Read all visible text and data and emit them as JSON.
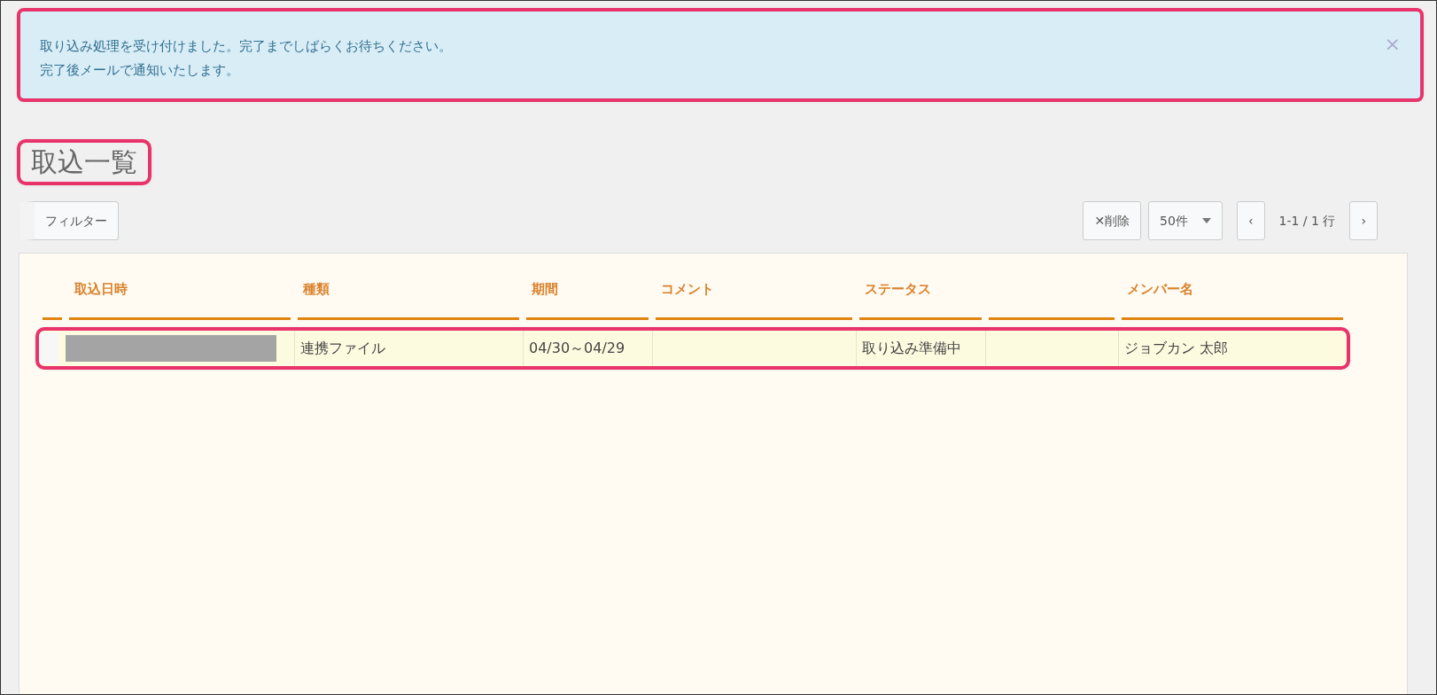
{
  "alert": {
    "lines": [
      "取り込み処理を受け付けました。完了までしばらくお待ちください。",
      "完了後メールで通知いたします。"
    ],
    "close": "×",
    "highlighted": true
  },
  "heading": {
    "text": "取込一覧",
    "highlighted": true
  },
  "toolbar": {
    "filter": "フィルター",
    "delete": "✕削除",
    "page_size": "50件",
    "prev": "‹",
    "range": "1-1 / 1 行",
    "next": "›"
  },
  "table": {
    "columns": [
      {
        "kind": "select"
      },
      {
        "kind": "text",
        "label": "取込日時"
      },
      {
        "kind": "text",
        "label": "種類"
      },
      {
        "kind": "text",
        "label": "期間"
      },
      {
        "kind": "text",
        "label": "コメント"
      },
      {
        "kind": "text",
        "label": "ステータス"
      },
      {
        "kind": "text"
      },
      {
        "kind": "text",
        "label": "メンバー名"
      }
    ],
    "rows": [
      {
        "highlighted": true,
        "cells": [
          {
            "kind": "select"
          },
          {
            "kind": "redacted"
          },
          {
            "kind": "text",
            "text": "連携ファイル"
          },
          {
            "kind": "text",
            "text": "04/30～04/29"
          },
          {
            "kind": "text"
          },
          {
            "kind": "text",
            "text": "取り込み準備中"
          },
          {
            "kind": "text"
          },
          {
            "kind": "text",
            "text": "ジョブカン 太郎"
          }
        ]
      }
    ]
  }
}
